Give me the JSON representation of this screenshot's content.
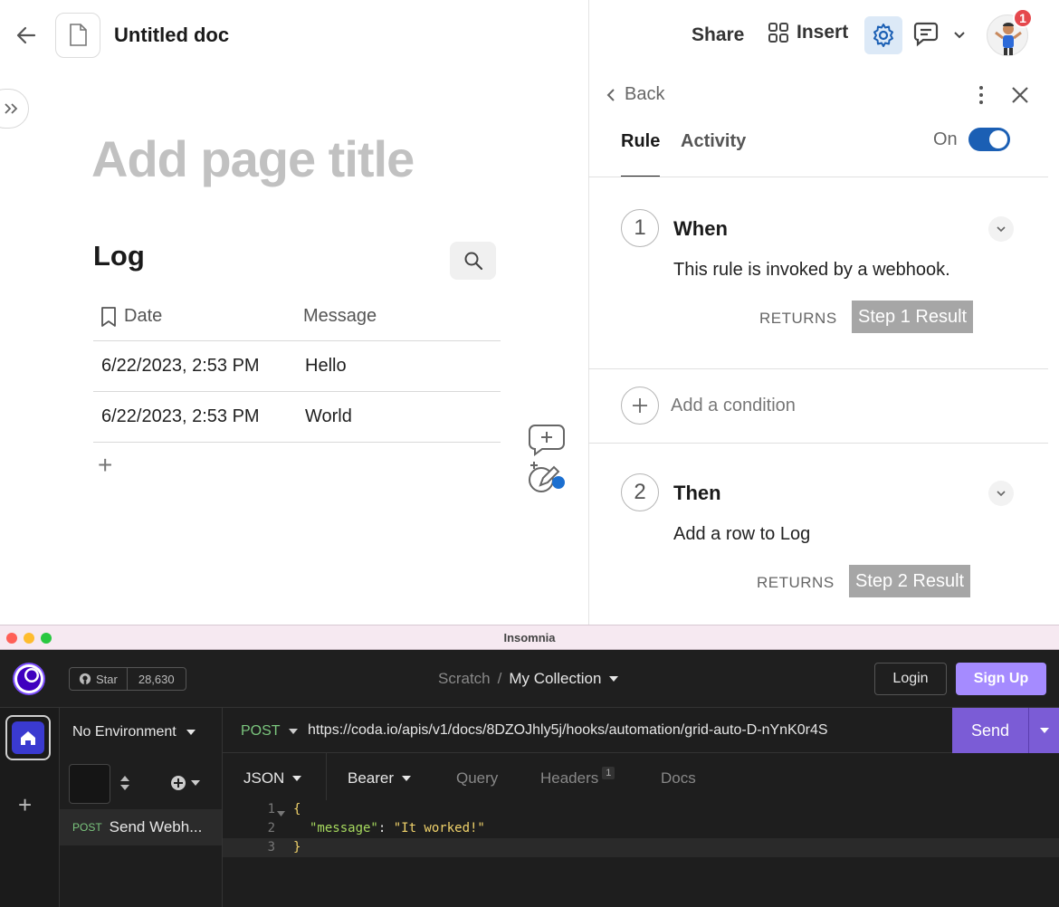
{
  "coda": {
    "doc_title": "Untitled doc",
    "page_title_placeholder": "Add page title",
    "table": {
      "title": "Log",
      "columns": [
        "Date",
        "Message"
      ],
      "rows": [
        {
          "date": "6/22/2023, 2:53 PM",
          "message": "Hello"
        },
        {
          "date": "6/22/2023, 2:53 PM",
          "message": "World"
        }
      ]
    },
    "header": {
      "share_label": "Share",
      "insert_label": "Insert",
      "notification_count": "1"
    },
    "panel": {
      "back_label": "Back",
      "tabs": [
        "Rule",
        "Activity"
      ],
      "toggle_label": "On",
      "steps": [
        {
          "number": "1",
          "title": "When",
          "description": "This rule is invoked by a webhook.",
          "returns_label": "RETURNS",
          "result": "Step 1 Result"
        },
        {
          "number": "2",
          "title": "Then",
          "description": "Add a row to Log",
          "returns_label": "RETURNS",
          "result": "Step 2 Result"
        }
      ],
      "add_condition_label": "Add a condition"
    },
    "colors": {
      "accent": "#1b5fb4",
      "gear_bg": "#dce9f7",
      "badge": "#e5484d"
    }
  },
  "insomnia": {
    "window_title": "Insomnia",
    "star_label": "Star",
    "star_count": "28,630",
    "breadcrumb": {
      "scratch": "Scratch",
      "separator": "/",
      "collection": "My Collection"
    },
    "login_label": "Login",
    "signup_label": "Sign Up",
    "environment": "No Environment",
    "request": {
      "method": "POST",
      "name": "Send Webh..."
    },
    "url_bar": {
      "method": "POST",
      "url": "https://coda.io/apis/v1/docs/8DZOJhly5j/hooks/automation/grid-auto-D-nYnK0r4S",
      "send_label": "Send"
    },
    "tabs": {
      "body": "JSON",
      "auth": "Bearer",
      "query": "Query",
      "headers": "Headers",
      "headers_count": "1",
      "docs": "Docs"
    },
    "code": {
      "line_numbers": [
        "1",
        "2",
        "3"
      ],
      "open_brace": "{",
      "key": "\"message\"",
      "colon": ": ",
      "value": "\"It worked!\"",
      "close_brace": "}"
    },
    "colors": {
      "send": "#7b5cd6",
      "signup": "#a58bff",
      "method": "#7bc67e"
    }
  }
}
